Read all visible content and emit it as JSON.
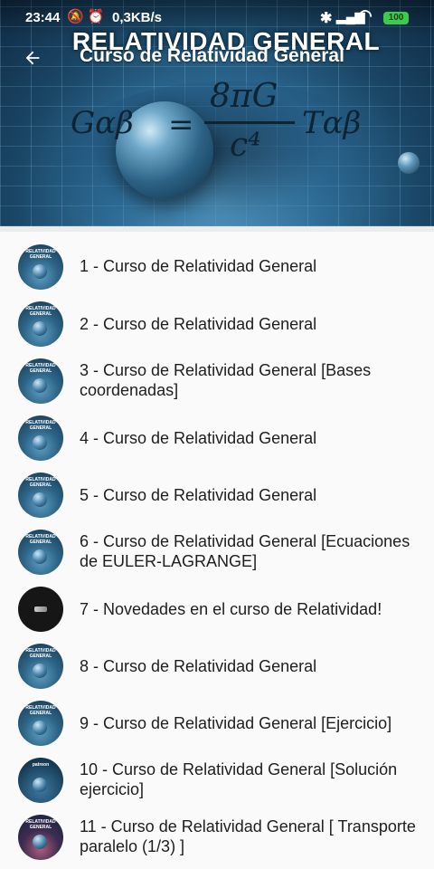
{
  "status_bar": {
    "time": "23:44",
    "left_icons": "🔕 ⏰",
    "speed": "0,3KB/s",
    "battery": "100"
  },
  "toolbar": {
    "title": "Curso de Relatividad General"
  },
  "header_image": {
    "title": "RELATIVIDAD GENERAL",
    "equation": {
      "lhs": "Gαβ",
      "eq": "=",
      "numerator": "8πG",
      "denominator": "c⁴",
      "rhs": "Tαβ"
    }
  },
  "items": [
    {
      "title": "1 - Curso de Relatividad General",
      "thumb": "RELATIVIDAD GENERAL"
    },
    {
      "title": "2 - Curso de Relatividad General",
      "thumb": "RELATIVIDAD GENERAL"
    },
    {
      "title": "3 - Curso de Relatividad General [Bases coordenadas]",
      "thumb": "RELATIVIDAD GENERAL"
    },
    {
      "title": "4 - Curso de Relatividad General",
      "thumb": "RELATIVIDAD GENERAL"
    },
    {
      "title": "5 - Curso de Relatividad General",
      "thumb": "RELATIVIDAD GENERAL"
    },
    {
      "title": "6 - Curso de Relatividad General [Ecuaciones de EULER-LAGRANGE]",
      "thumb": "RELATIVIDAD GENERAL"
    },
    {
      "title": "7 -  Novedades en el curso de Relatividad!",
      "thumb": ""
    },
    {
      "title": "8 - Curso de Relatividad General",
      "thumb": "RELATIVIDAD GENERAL"
    },
    {
      "title": "9 - Curso de Relatividad General [Ejercicio]",
      "thumb": "RELATIVIDAD GENERAL"
    },
    {
      "title": "10 - Curso de Relatividad General [Solución ejercicio]",
      "thumb": "patreon"
    },
    {
      "title": "11 - Curso de Relatividad General [ Transporte paralelo (1/3) ]",
      "thumb": "RELATIVIDAD GENERAL"
    }
  ],
  "colors": {
    "battery": "#3ccb4e",
    "list_background": "#fafafa",
    "text": "#1e1e1e"
  }
}
